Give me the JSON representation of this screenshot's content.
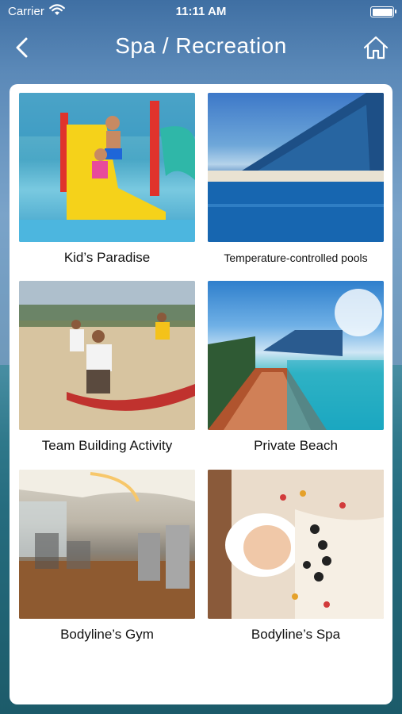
{
  "status_bar": {
    "carrier": "Carrier",
    "time": "11:11 AM"
  },
  "nav": {
    "title": "Spa / Recreation",
    "back_icon": "chevron-left-icon",
    "home_icon": "home-icon"
  },
  "tiles": [
    {
      "label": "Kid’s Paradise",
      "image": "kids-water-slide"
    },
    {
      "label": "Temperature-controlled pools",
      "image": "hotel-pool"
    },
    {
      "label": "Team Building Activity",
      "image": "beach-tug-of-war"
    },
    {
      "label": "Private Beach",
      "image": "beach-boardwalk"
    },
    {
      "label": "Bodyline’s Gym",
      "image": "gym-treadmills"
    },
    {
      "label": "Bodyline’s Spa",
      "image": "spa-hot-stones"
    }
  ],
  "colors": {
    "background_top": "#3f6fa3",
    "background_bottom": "#1d5566",
    "card": "#ffffff",
    "text": "#111111"
  }
}
